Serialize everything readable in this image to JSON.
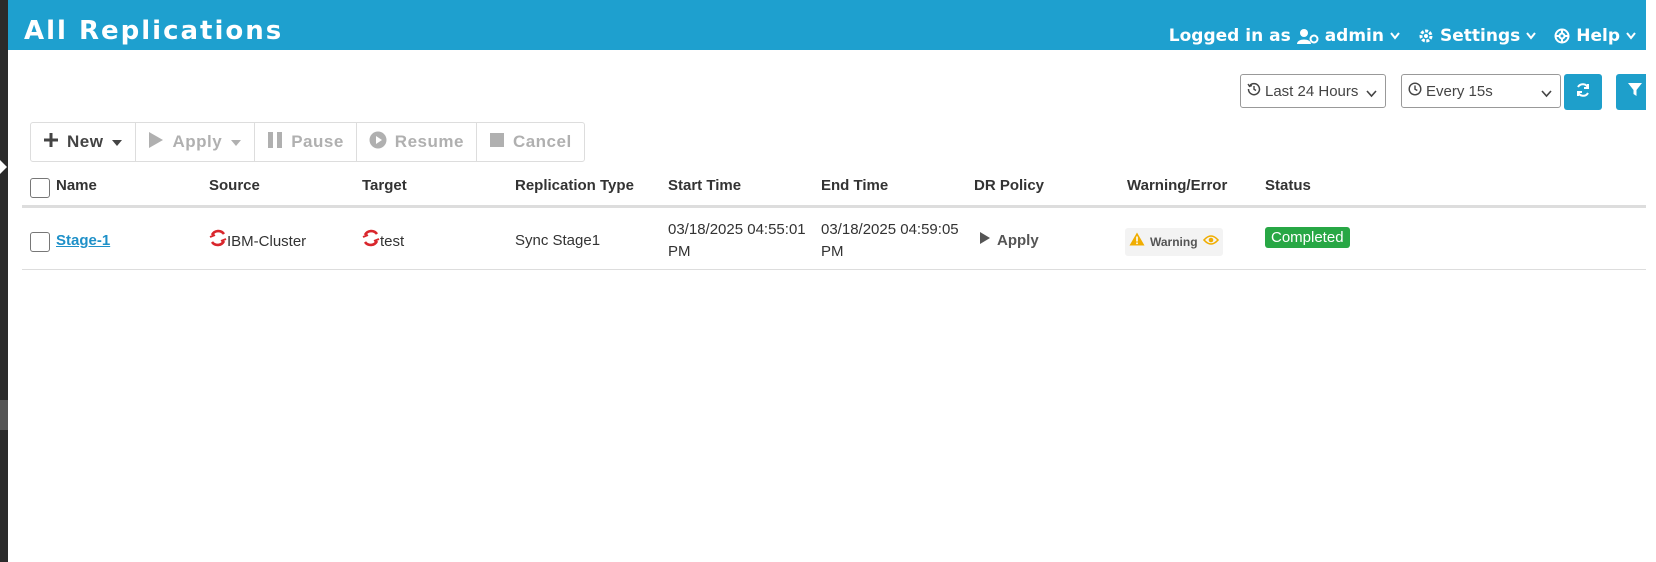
{
  "header": {
    "title": "All Replications",
    "logged_in_label": "Logged in as",
    "user": "admin",
    "settings_label": "Settings",
    "help_label": "Help",
    "bg_color": "#1ea0cf"
  },
  "filters": {
    "time_range": "Last 24 Hours",
    "refresh_interval": "Every 15s"
  },
  "toolbar": {
    "new_label": "New",
    "apply_label": "Apply",
    "pause_label": "Pause",
    "resume_label": "Resume",
    "cancel_label": "Cancel"
  },
  "table": {
    "columns": [
      "Name",
      "Source",
      "Target",
      "Replication Type",
      "Start Time",
      "End Time",
      "DR Policy",
      "Warning/Error",
      "Status"
    ],
    "rows": [
      {
        "name": "Stage-1",
        "source": "IBM-Cluster",
        "target": "test",
        "replication_type": "Sync Stage1",
        "start_time_line1": "03/18/2025 04:55:01",
        "start_time_line2": "PM",
        "end_time_line1": "03/18/2025 04:59:05",
        "end_time_line2": "PM",
        "dr_policy": "Apply",
        "warning": "Warning",
        "status": "Completed"
      }
    ]
  },
  "icons": {
    "cluster_icon": "openshift-icon",
    "status_color": "#28a745",
    "warning_color": "#f0ad00"
  }
}
